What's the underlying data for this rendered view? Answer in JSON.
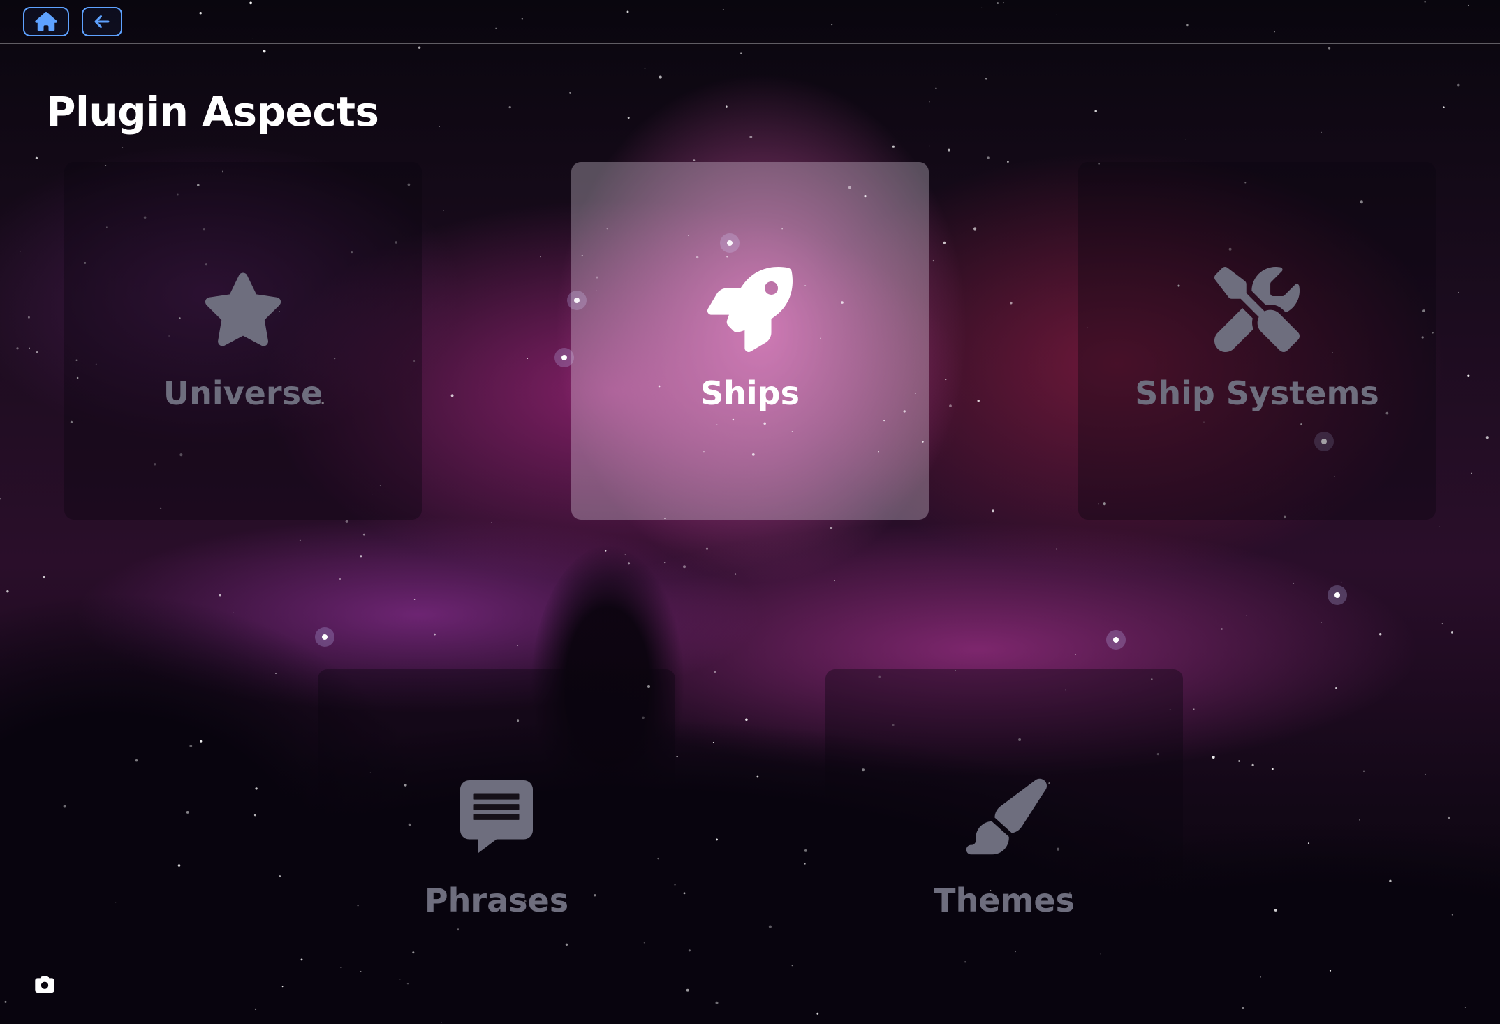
{
  "topbar": {
    "home_icon": "home-icon",
    "back_icon": "arrow-left-icon",
    "accent_color": "#5ea2ff"
  },
  "page": {
    "title": "Plugin Aspects"
  },
  "tiles": [
    {
      "label": "Universe",
      "icon": "star-icon",
      "active": false
    },
    {
      "label": "Ships",
      "icon": "rocket-icon",
      "active": true
    },
    {
      "label": "Ship Systems",
      "icon": "tools-icon",
      "active": false
    },
    {
      "label": "Phrases",
      "icon": "message-icon",
      "active": false
    },
    {
      "label": "Themes",
      "icon": "paint-brush-icon",
      "active": false
    }
  ],
  "footer": {
    "camera_icon": "camera-icon"
  },
  "colors": {
    "inactive_text": "#6e6e7e",
    "active_text": "#ffffff"
  }
}
